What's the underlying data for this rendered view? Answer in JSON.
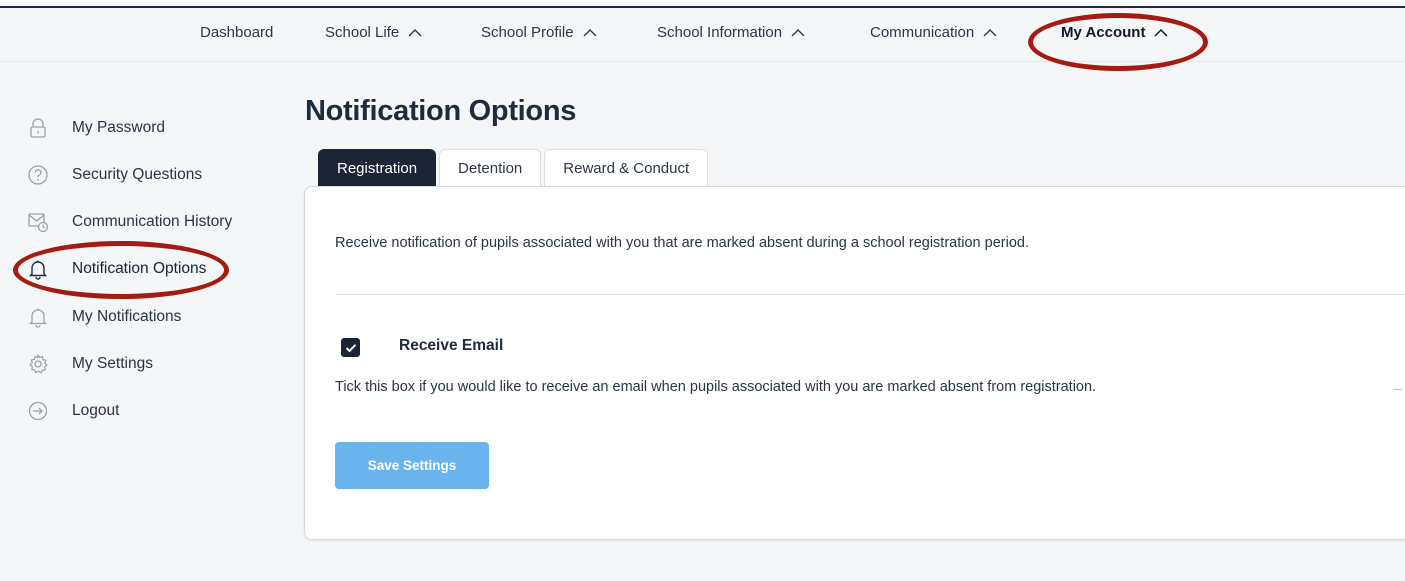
{
  "topnav": {
    "items": [
      {
        "label": "Dashboard",
        "caret": false
      },
      {
        "label": "School Life",
        "caret": true
      },
      {
        "label": "School Profile",
        "caret": true
      },
      {
        "label": "School Information",
        "caret": true
      },
      {
        "label": "Communication",
        "caret": true
      },
      {
        "label": "My Account",
        "caret": true,
        "active": true
      }
    ]
  },
  "sidebar": {
    "items": [
      {
        "label": "My Password",
        "icon": "lock-icon"
      },
      {
        "label": "Security Questions",
        "icon": "question-circle-icon"
      },
      {
        "label": "Communication History",
        "icon": "mail-clock-icon"
      },
      {
        "label": "Notification Options",
        "icon": "bell-icon",
        "active": true
      },
      {
        "label": "My Notifications",
        "icon": "bell-outline-icon"
      },
      {
        "label": "My Settings",
        "icon": "gear-icon"
      },
      {
        "label": "Logout",
        "icon": "logout-icon"
      }
    ]
  },
  "page": {
    "title": "Notification Options"
  },
  "tabs": [
    {
      "label": "Registration",
      "active": true
    },
    {
      "label": "Detention"
    },
    {
      "label": "Reward & Conduct"
    }
  ],
  "panel": {
    "description": "Receive notification of pupils associated with you that are marked absent during a school registration period.",
    "checkbox_label": "Receive Email",
    "checkbox_checked": true,
    "help_text": "Tick this box if you would like to receive an email when pupils associated with you are marked absent from registration.",
    "save_label": "Save Settings"
  },
  "colors": {
    "accent_dark": "#1c2536",
    "button_blue": "#6ab4ee",
    "highlight_ring": "#a31b12"
  }
}
